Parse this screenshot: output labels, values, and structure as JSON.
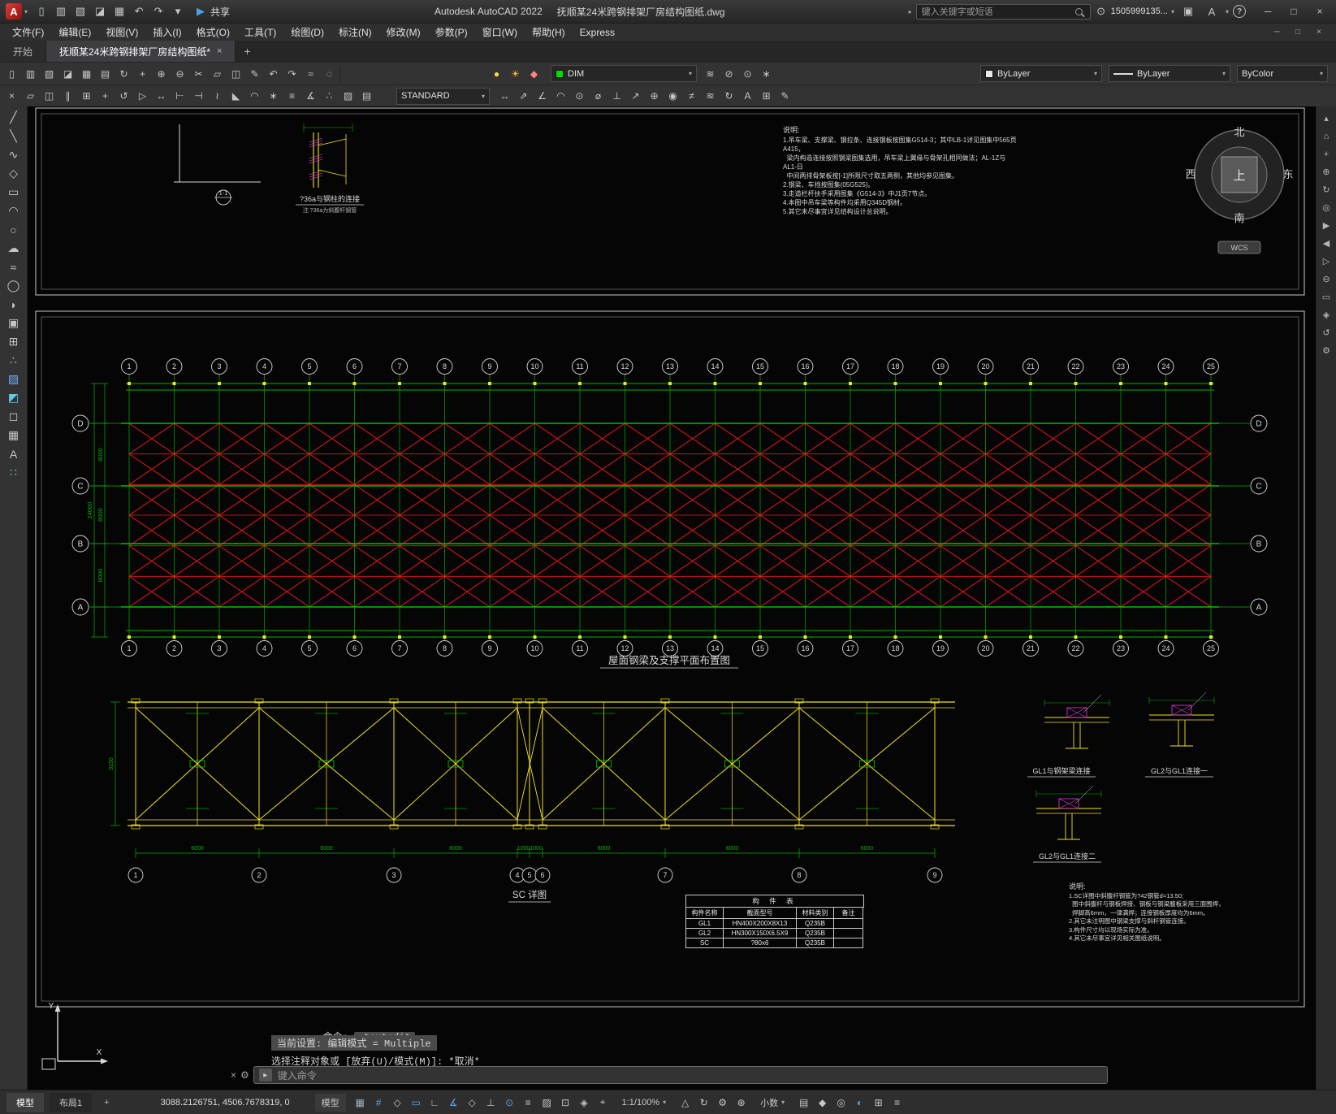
{
  "ui": {
    "caret": "▾",
    "collapse": "▸",
    "person": "⊙",
    "cart": "▣",
    "help": "?",
    "min": "─",
    "max": "□",
    "close": "×",
    "plus": "+",
    "gear": "⚙"
  },
  "titlebar": {
    "app_label": "A",
    "share_label": "共享",
    "share_glyph": "▶",
    "app_title": "Autodesk AutoCAD 2022",
    "doc_title": "抚顺某24米跨钢排架厂房结构图纸.dwg",
    "search_placeholder": "键入关键字或短语",
    "user_id": "1505999135...",
    "qat_icons": [
      {
        "n": "new-file-icon",
        "g": "▯"
      },
      {
        "n": "open-file-icon",
        "g": "▥"
      },
      {
        "n": "save-icon",
        "g": "▧"
      },
      {
        "n": "save-as-icon",
        "g": "◪"
      },
      {
        "n": "plot-icon",
        "g": "▦"
      },
      {
        "n": "undo-icon",
        "g": "↶"
      },
      {
        "n": "redo-icon",
        "g": "↷"
      },
      {
        "n": "qat-customize-icon",
        "g": "▾"
      }
    ]
  },
  "menubar": {
    "items": [
      "文件(F)",
      "编辑(E)",
      "视图(V)",
      "插入(I)",
      "格式(O)",
      "工具(T)",
      "绘图(D)",
      "标注(N)",
      "修改(M)",
      "参数(P)",
      "窗口(W)",
      "帮助(H)",
      "Express"
    ]
  },
  "tabs": {
    "start": "开始",
    "doc": "抚顺某24米跨钢排架厂房结构图纸*"
  },
  "toolbar1": {
    "icons": [
      {
        "n": "qnew-icon",
        "g": "▯"
      },
      {
        "n": "open-icon",
        "g": "▥"
      },
      {
        "n": "save-toolbar-icon",
        "g": "▧"
      },
      {
        "n": "saveas-icon",
        "g": "◪"
      },
      {
        "n": "plot-toolbar-icon",
        "g": "▦"
      },
      {
        "n": "publish-icon",
        "g": "▤"
      },
      {
        "n": "orbit-icon",
        "g": "↻"
      },
      {
        "n": "pan-toolbar-icon",
        "g": "+"
      },
      {
        "n": "zoom-window-icon",
        "g": "⊕"
      },
      {
        "n": "zoom-extents-icon",
        "g": "⊖"
      },
      {
        "n": "cut-icon",
        "g": "✂"
      },
      {
        "n": "copy-clip-icon",
        "g": "▱"
      },
      {
        "n": "paste-icon",
        "g": "◫"
      },
      {
        "n": "match-properties-icon",
        "g": "✎"
      },
      {
        "n": "undo-toolbar-icon",
        "g": "↶"
      },
      {
        "n": "redo-toolbar-icon",
        "g": "↷"
      },
      {
        "n": "field-icon",
        "g": "≈"
      },
      {
        "n": "view-icon",
        "g": "◌"
      }
    ],
    "light_icons": [
      {
        "n": "layer-light-icon",
        "g": "●",
        "c": "#ffd54a"
      },
      {
        "n": "layer-sun-icon",
        "g": "☀",
        "c": "#ffc33d"
      },
      {
        "n": "layer-lock-icon",
        "g": "◆",
        "c": "#ff8484"
      }
    ],
    "layer_combo": {
      "label": "DIM",
      "swatch": "#00dd00"
    },
    "layer_tool_icons": [
      {
        "n": "layer-properties-icon",
        "g": "≋"
      },
      {
        "n": "layer-off-icon",
        "g": "⊘"
      },
      {
        "n": "layer-isolate-icon",
        "g": "⊙"
      },
      {
        "n": "layer-freeze-icon",
        "g": "∗"
      }
    ],
    "color_combo": "ByLayer",
    "linetype_combo": "ByLayer",
    "plotstyle_combo": "ByColor"
  },
  "toolbar2": {
    "left_icons": [
      {
        "n": "erase-icon",
        "g": "×"
      },
      {
        "n": "copy-icon",
        "g": "▱"
      },
      {
        "n": "mirror-icon",
        "g": "◫"
      },
      {
        "n": "offset-icon",
        "g": "∥"
      },
      {
        "n": "array-icon",
        "g": "⊞"
      },
      {
        "n": "move-icon",
        "g": "+"
      },
      {
        "n": "rotate-icon",
        "g": "↺"
      },
      {
        "n": "scale-icon",
        "g": "▷"
      },
      {
        "n": "stretch-icon",
        "g": "↔"
      },
      {
        "n": "trim-icon",
        "g": "⊢"
      },
      {
        "n": "extend-icon",
        "g": "⊣"
      },
      {
        "n": "break-icon",
        "g": "≀"
      },
      {
        "n": "chamfer-icon",
        "g": "◣"
      },
      {
        "n": "fillet-icon",
        "g": "◠"
      },
      {
        "n": "explode-icon",
        "g": "∗"
      },
      {
        "n": "join-icon",
        "g": "≡"
      },
      {
        "n": "measure-icon",
        "g": "∡"
      },
      {
        "n": "divide-icon",
        "g": "∴"
      },
      {
        "n": "hatch-edit-icon",
        "g": "▨"
      },
      {
        "n": "properties-icon",
        "g": "▤"
      }
    ],
    "style_combo": "STANDARD",
    "right_icons": [
      {
        "n": "dim-linear-icon",
        "g": "↔"
      },
      {
        "n": "dim-aligned-icon",
        "g": "⇗"
      },
      {
        "n": "dim-angular-icon",
        "g": "∠"
      },
      {
        "n": "dim-arc-icon",
        "g": "◠"
      },
      {
        "n": "dim-radius-icon",
        "g": "⊙"
      },
      {
        "n": "dim-diameter-icon",
        "g": "⌀"
      },
      {
        "n": "dim-ordinate-icon",
        "g": "⊥"
      },
      {
        "n": "qleader-icon",
        "g": "↗"
      },
      {
        "n": "tolerance-icon",
        "g": "⊕"
      },
      {
        "n": "center-mark-icon",
        "g": "◉"
      },
      {
        "n": "dim-break-icon",
        "g": "≠"
      },
      {
        "n": "dim-space-icon",
        "g": "≋"
      },
      {
        "n": "dim-update-icon",
        "g": "↻"
      },
      {
        "n": "mtext-icon",
        "g": "A"
      },
      {
        "n": "table-tool-icon",
        "g": "⊞"
      },
      {
        "n": "dim-style-icon",
        "g": "✎"
      }
    ]
  },
  "left_palette": [
    {
      "n": "line-icon",
      "g": "╱"
    },
    {
      "n": "construction-line-icon",
      "g": "╲"
    },
    {
      "n": "polyline-icon",
      "g": "∿"
    },
    {
      "n": "polygon-icon",
      "g": "◇"
    },
    {
      "n": "rectangle-icon",
      "g": "▭"
    },
    {
      "n": "arc-icon",
      "g": "◠"
    },
    {
      "n": "circle-icon",
      "g": "○"
    },
    {
      "n": "revision-cloud-icon",
      "g": "☁"
    },
    {
      "n": "spline-icon",
      "g": "≈"
    },
    {
      "n": "ellipse-icon",
      "g": "◯"
    },
    {
      "n": "ellipse-arc-icon",
      "g": "◗"
    },
    {
      "n": "insert-block-icon",
      "g": "▣"
    },
    {
      "n": "create-block-icon",
      "g": "⊞"
    },
    {
      "n": "point-icon",
      "g": "∴"
    },
    {
      "n": "hatch-icon",
      "g": "▨",
      "c": "#6db1ff"
    },
    {
      "n": "gradient-icon",
      "g": "◩",
      "c": "#62c8e8"
    },
    {
      "n": "region-icon",
      "g": "◻"
    },
    {
      "n": "table-icon",
      "g": "▦"
    },
    {
      "n": "multiline-text-icon",
      "g": "A"
    },
    {
      "n": "point-style-icon",
      "g": "∷",
      "c": "#7bd87b"
    }
  ],
  "right_navbar": [
    {
      "n": "nav-collapse-icon",
      "g": "▴"
    },
    {
      "n": "viewcube-home-icon",
      "g": "⌂"
    },
    {
      "n": "pan-icon",
      "g": "+"
    },
    {
      "n": "zoom-in-icon",
      "g": "⊕"
    },
    {
      "n": "orbit-tool-icon",
      "g": "↻"
    },
    {
      "n": "steering-wheel-icon",
      "g": "◎"
    },
    {
      "n": "show-motion-icon",
      "g": "▶"
    },
    {
      "n": "previous-view-icon",
      "g": "◀"
    },
    {
      "n": "next-view-icon",
      "g": "▷"
    },
    {
      "n": "zoom-out-icon",
      "g": "⊖"
    },
    {
      "n": "zoom-window-nav-icon",
      "g": "▭"
    },
    {
      "n": "zoom-extents-nav-icon",
      "g": "◈"
    },
    {
      "n": "refresh-icon",
      "g": "↺"
    },
    {
      "n": "nav-settings-icon",
      "g": "⚙"
    }
  ],
  "drawing": {
    "plan": {
      "title": "屋面钢梁及支撑平面布置图",
      "cols": [
        "1",
        "2",
        "3",
        "4",
        "5",
        "6",
        "7",
        "8",
        "9",
        "10",
        "11",
        "12",
        "13",
        "14",
        "15",
        "16",
        "17",
        "18",
        "19",
        "20",
        "21",
        "22",
        "23",
        "24",
        "25"
      ],
      "rows": [
        "D",
        "C",
        "B",
        "A"
      ],
      "dims_left": [
        "8000",
        "8000",
        "8000"
      ],
      "dim_total": "24000"
    },
    "truss": {
      "title": "SC 详图",
      "bubbles": [
        "1",
        "2",
        "3",
        "4",
        "5",
        "6",
        "7",
        "8",
        "9"
      ],
      "dims": [
        "6000",
        "6000",
        "6000",
        "1000",
        "1000",
        "6000",
        "6000",
        "6000"
      ],
      "height_dim": "3150"
    },
    "details": [
      "GL1与钢架梁连接",
      "GL2与GL1连接一",
      "GL2与GL1连接二"
    ],
    "detail_top": {
      "title": "?36a与钢柱的连接",
      "sub": "注:?36a为斜腹杆钢管"
    },
    "section_label": "1-1",
    "ucs_labels": {
      "x": "X",
      "y": "Y"
    },
    "compass": {
      "north": "北",
      "south": "南",
      "east": "东",
      "west": "西",
      "up": "上"
    },
    "wcs": "WCS",
    "notes_top": {
      "title": "说明:",
      "lines": [
        "1.吊车梁、支撑梁、钢拉条、连接钢板按图集G514-3；其中LB-1详见图集中565页A415，",
        "  梁内构造连接按照钢梁图集选用，吊车梁上翼缘与骨架孔相同做法；AL-1Z与AL1-日",
        "  中间两排骨架板按[-1]所限尺寸取五两侧，其他均参见图集。",
        "2.钢梁、车挡按图集(05G525)。",
        "3.走道栏杆扶手采用图集《G514-3》中J1页7节点。",
        "4.本图中吊车梁等构件均采用Q345D钢材。",
        "5.其它未尽事宜详见结构设计总说明。"
      ]
    },
    "notes_bottom": {
      "title": "说明:",
      "lines": [
        "1.SC详图中斜腹杆钢管为?42钢管d=13.50;",
        "  图中斜腹杆与钢板焊接、钢板与钢梁腹板采用三面围焊，",
        "  焊脚高6mm，一律满焊；连接钢板厚度均为6mm。",
        "2.其它未注明图中钢梁支撑与斜杆钢管连接。",
        "3.构件尺寸均以现场实际为准。",
        "4.其它未尽事宜详见相关图纸说明。"
      ]
    },
    "table": {
      "title": "构 件 表",
      "headers": [
        "构件名称",
        "截面型号",
        "材料类别",
        "备注"
      ],
      "rows": [
        [
          "GL1",
          "HN400X200X8X13",
          "Q235B",
          ""
        ],
        [
          "GL2",
          "HN300X150X6.5X9",
          "Q235B",
          ""
        ],
        [
          "SC",
          "?80x6",
          "Q235B",
          ""
        ]
      ]
    },
    "colors": {
      "green": "#00b400",
      "bright_green": "#00e000",
      "red": "#e81717",
      "yellow": "#f2e41f",
      "magenta": "#e040e0",
      "white": "#d9d9d9"
    }
  },
  "command": {
    "prompt_label": "命令:",
    "current_command": "_textedit",
    "line2": "当前设置: 编辑模式 = Multiple",
    "line3": "选择注释对象或 [放弃(U)/模式(M)]: *取消*",
    "placeholder": "键入命令"
  },
  "statusbar": {
    "model_tab": "模型",
    "layout_tab": "布局1",
    "coords": "3088.2126751, 4506.7678319, 0",
    "model_label": "模型",
    "scale": "1:1/100%",
    "units": "小数",
    "icons_left": [
      {
        "n": "grid-display-icon",
        "g": "▦",
        "c": "#9db4c6"
      },
      {
        "n": "snap-mode-icon",
        "g": "#",
        "c": "#58a6e8"
      },
      {
        "n": "infer-constraints-icon",
        "g": "◇"
      },
      {
        "n": "dynamic-input-icon",
        "g": "▭",
        "c": "#58a6e8"
      },
      {
        "n": "ortho-mode-icon",
        "g": "∟"
      },
      {
        "n": "polar-tracking-icon",
        "g": "∡",
        "c": "#58a6e8"
      },
      {
        "n": "isometric-drafting-icon",
        "g": "◇"
      },
      {
        "n": "object-snap-tracking-icon",
        "g": "⊥"
      },
      {
        "n": "object-snap-icon",
        "g": "⊙",
        "c": "#58a6e8"
      },
      {
        "n": "lineweight-icon",
        "g": "≡"
      },
      {
        "n": "transparency-icon",
        "g": "▨"
      },
      {
        "n": "selection-cycling-icon",
        "g": "⊡"
      },
      {
        "n": "3d-object-snap-icon",
        "g": "◈"
      },
      {
        "n": "dynamic-ucs-icon",
        "g": "⌖"
      }
    ],
    "icons_mid": [
      {
        "n": "annotation-visibility-icon",
        "g": "△"
      },
      {
        "n": "annotation-autoscale-icon",
        "g": "↻"
      },
      {
        "n": "workspace-switching-icon",
        "g": "⚙"
      },
      {
        "n": "annotation-monitor-icon",
        "g": "⊕"
      }
    ],
    "icons_right": [
      {
        "n": "quick-properties-icon",
        "g": "▤"
      },
      {
        "n": "lock-ui-icon",
        "g": "◆"
      },
      {
        "n": "isolate-objects-icon",
        "g": "◎"
      },
      {
        "n": "graphics-performance-icon",
        "g": "◐",
        "c": "#58a6e8"
      },
      {
        "n": "clean-screen-icon",
        "g": "⊞"
      },
      {
        "n": "customization-icon",
        "g": "≡"
      }
    ]
  }
}
